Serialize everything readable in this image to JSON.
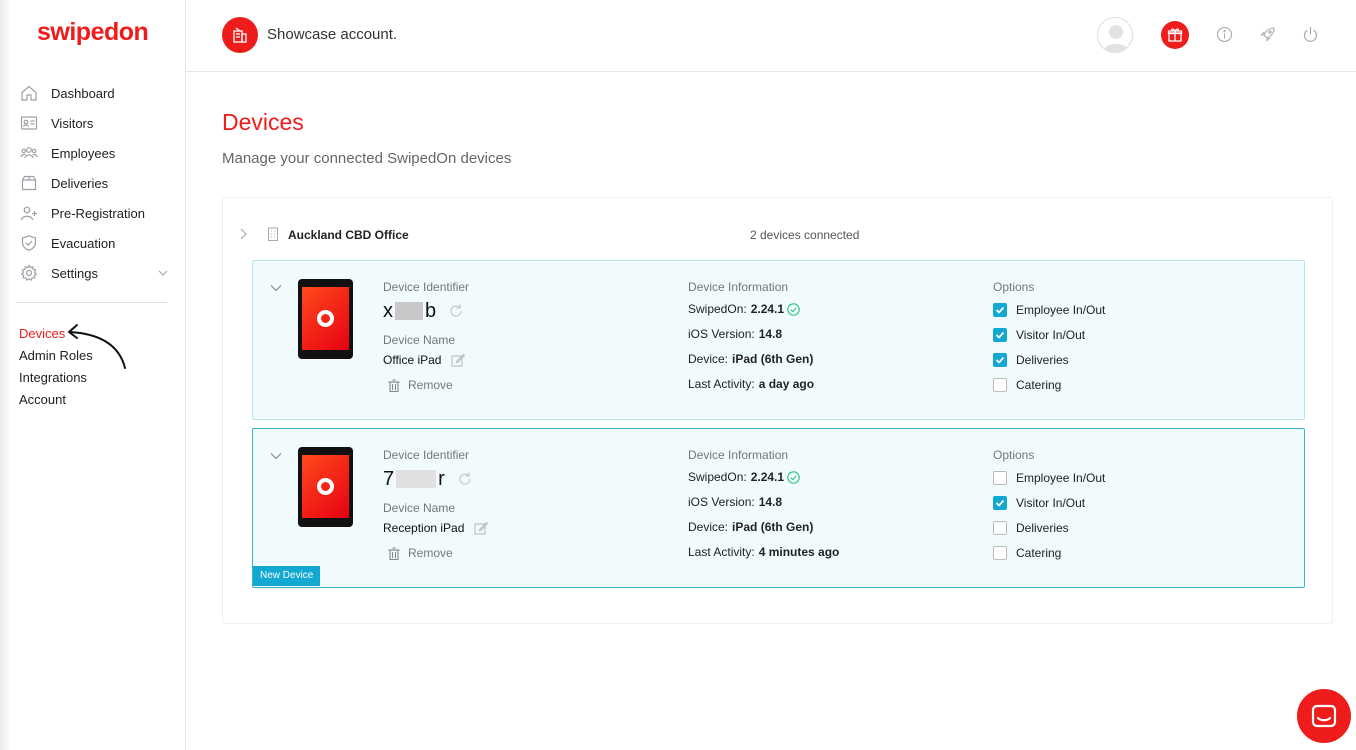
{
  "brand": {
    "logo": "swipedon",
    "accent": "#ef1c1c",
    "check_color": "#13a8d1"
  },
  "sidebar": {
    "items": [
      {
        "label": "Dashboard",
        "icon": "home-icon"
      },
      {
        "label": "Visitors",
        "icon": "id-card-icon"
      },
      {
        "label": "Employees",
        "icon": "people-icon"
      },
      {
        "label": "Deliveries",
        "icon": "box-icon"
      },
      {
        "label": "Pre-Registration",
        "icon": "add-person-icon"
      },
      {
        "label": "Evacuation",
        "icon": "shield-icon"
      },
      {
        "label": "Settings",
        "icon": "gear-icon"
      }
    ],
    "subitems": [
      {
        "label": "Devices",
        "active": true
      },
      {
        "label": "Admin Roles"
      },
      {
        "label": "Integrations"
      },
      {
        "label": "Account"
      }
    ]
  },
  "header": {
    "account_name": "Showcase account."
  },
  "main": {
    "title": "Devices",
    "subtitle": "Manage your connected SwipedOn devices",
    "location": {
      "name": "Auckland CBD Office",
      "count_text": "2 devices connected"
    },
    "labels": {
      "device_identifier": "Device Identifier",
      "device_name": "Device Name",
      "remove": "Remove",
      "device_information": "Device Information",
      "options": "Options",
      "swipedon": "SwipedOn:",
      "ios_version": "iOS Version:",
      "device": "Device:",
      "last_activity": "Last Activity:"
    },
    "devices": [
      {
        "id_start": "x",
        "id_end": "b",
        "name": "Office iPad",
        "swipedon_version": "2.24.1",
        "ios_version": "14.8",
        "device": "iPad (6th Gen)",
        "last_activity": "a day ago",
        "options": [
          {
            "label": "Employee In/Out",
            "checked": true
          },
          {
            "label": "Visitor In/Out",
            "checked": true
          },
          {
            "label": "Deliveries",
            "checked": true
          },
          {
            "label": "Catering",
            "checked": false
          }
        ]
      },
      {
        "id_start": "7",
        "id_end": "r",
        "name": "Reception iPad",
        "swipedon_version": "2.24.1",
        "ios_version": "14.8",
        "device": "iPad (6th Gen)",
        "last_activity": "4 minutes ago",
        "badge": "New Device",
        "options": [
          {
            "label": "Employee In/Out",
            "checked": false
          },
          {
            "label": "Visitor In/Out",
            "checked": true
          },
          {
            "label": "Deliveries",
            "checked": false
          },
          {
            "label": "Catering",
            "checked": false
          }
        ]
      }
    ]
  }
}
